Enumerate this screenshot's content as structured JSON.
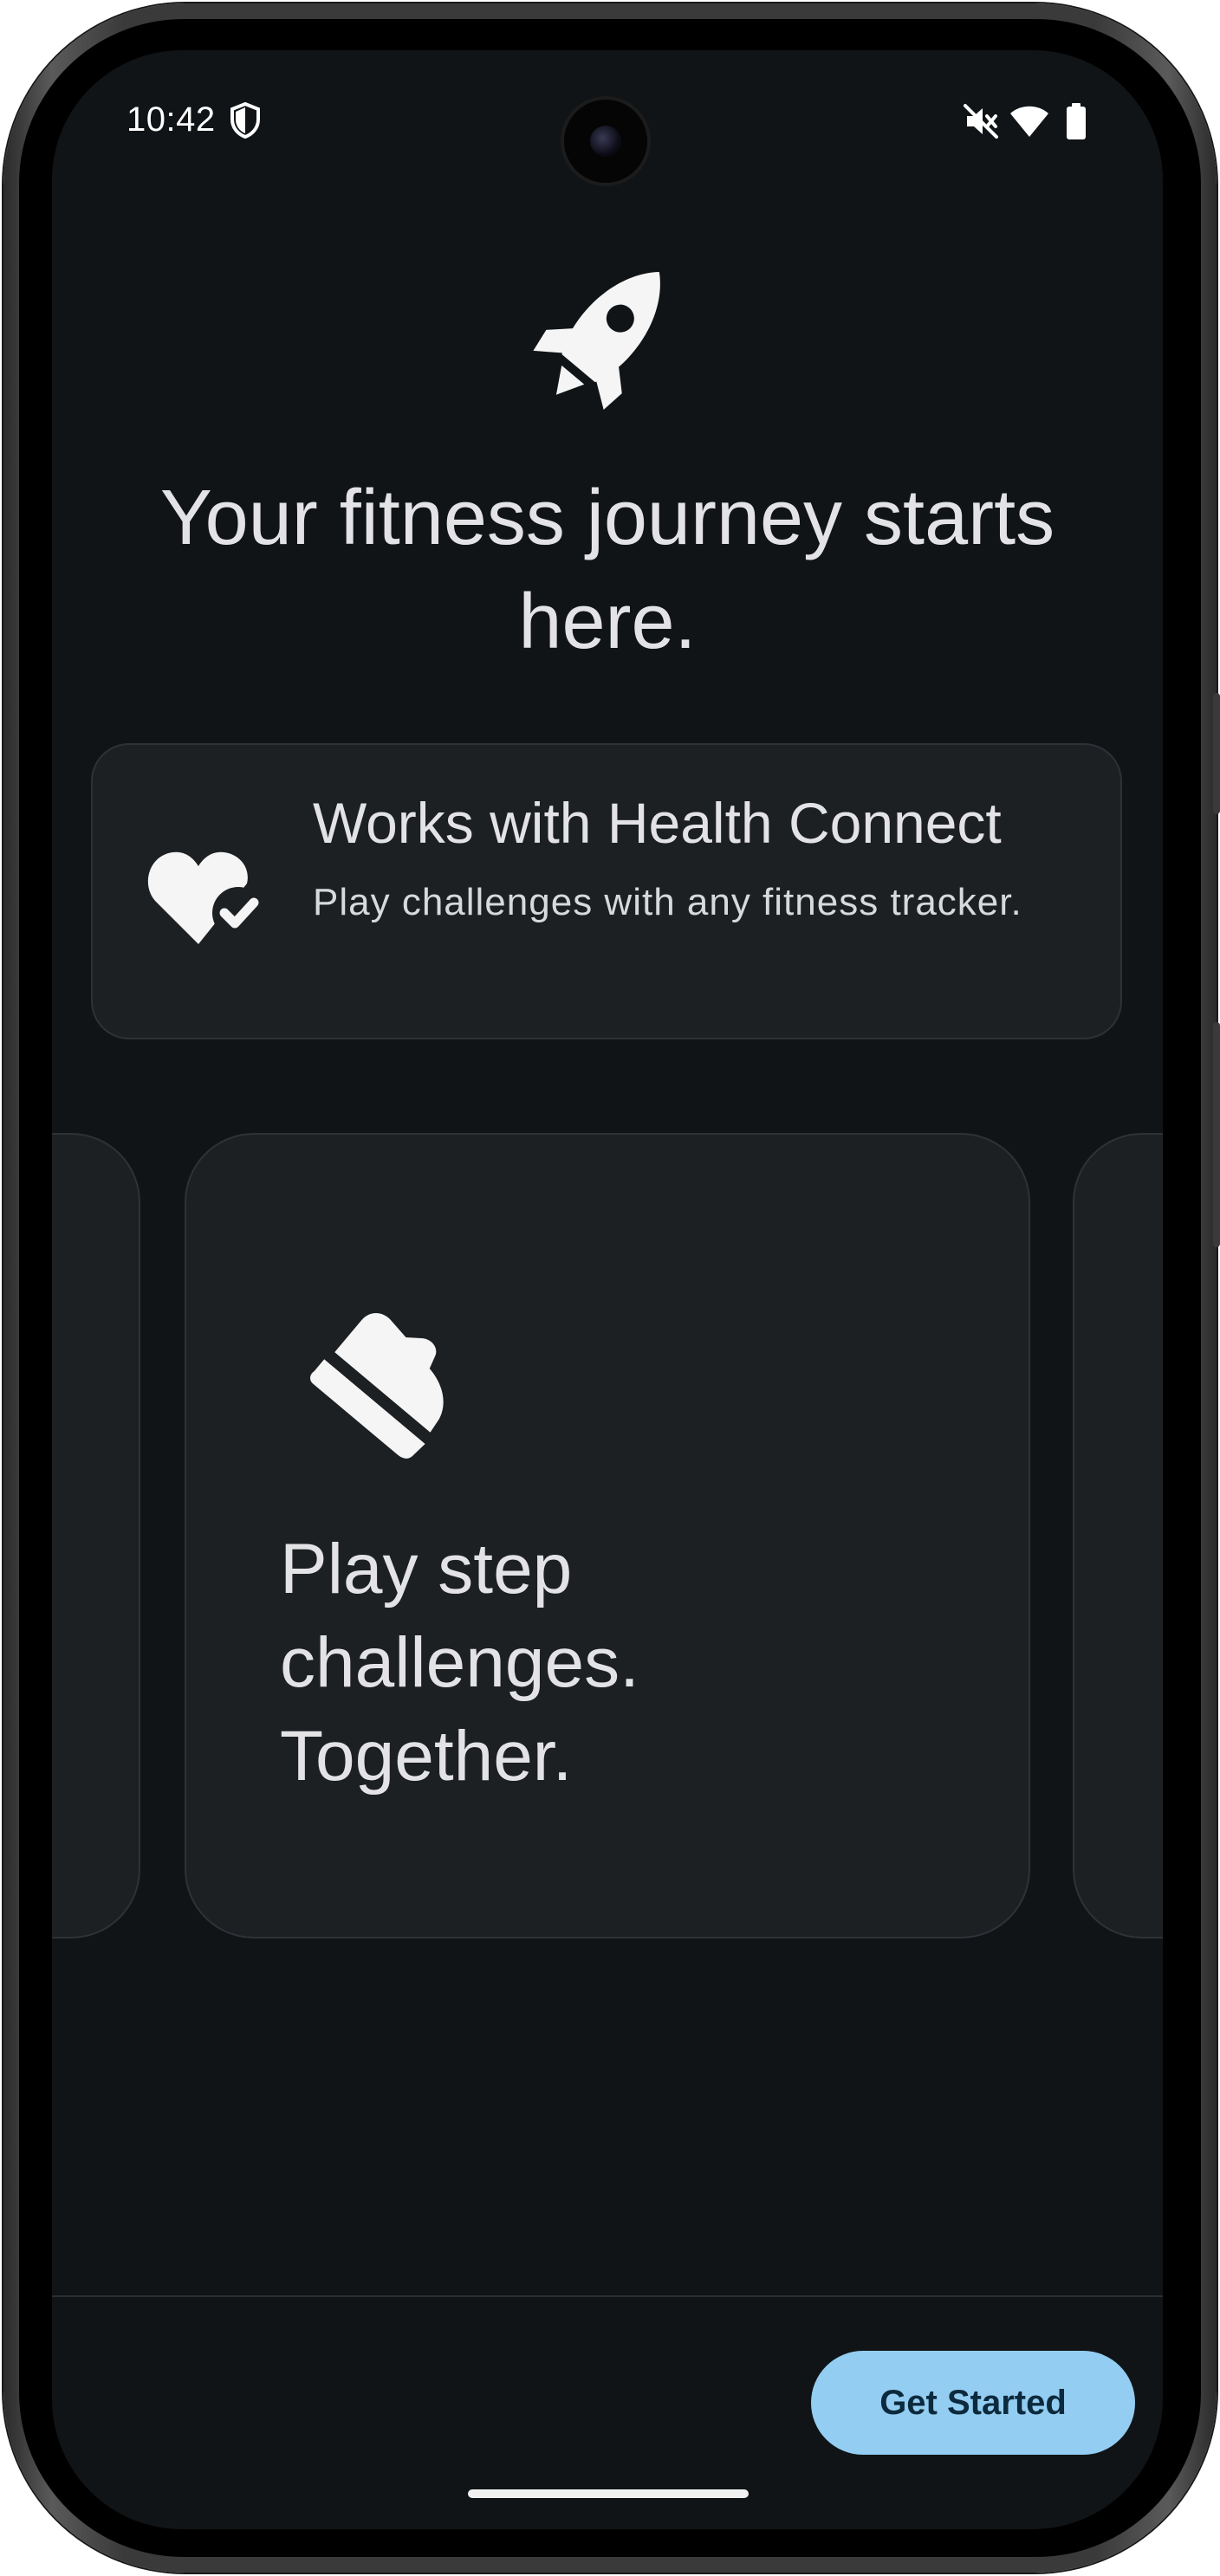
{
  "status_bar": {
    "time": "10:42",
    "icons": [
      "shield-icon",
      "mute-icon",
      "wifi-icon",
      "battery-icon"
    ]
  },
  "hero": {
    "icon": "rocket-icon",
    "headline": "Your fitness journey starts here."
  },
  "health_connect_card": {
    "icon": "heart-check-icon",
    "title": "Works with Health Connect",
    "subtitle": "Play challenges with any fitness tracker."
  },
  "carousel": {
    "current_card": {
      "icon": "sneaker-icon",
      "text": "Play step challenges. Together."
    }
  },
  "footer": {
    "cta_label": "Get Started"
  },
  "colors": {
    "background": "#101416",
    "card": "#1d2023",
    "accent_button": "#94cdf2",
    "text_primary": "#e3e3e6"
  }
}
